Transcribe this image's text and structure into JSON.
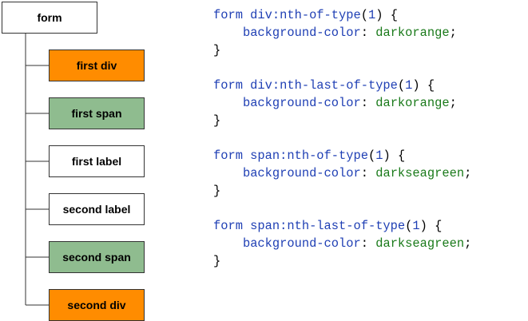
{
  "colors": {
    "darkorange": "#ff8c00",
    "darkseagreen": "#8fbc8f",
    "white": "#ffffff",
    "selector_blue": "#1f3fb4",
    "value_green": "#1a7a1a"
  },
  "tree": {
    "root": {
      "label": "form"
    },
    "children": [
      {
        "label": "first div",
        "fill": "#ff8c00"
      },
      {
        "label": "first span",
        "fill": "#8fbc8f"
      },
      {
        "label": "first label",
        "fill": "#ffffff"
      },
      {
        "label": "second label",
        "fill": "#ffffff"
      },
      {
        "label": "second span",
        "fill": "#8fbc8f"
      },
      {
        "label": "second div",
        "fill": "#ff8c00"
      }
    ]
  },
  "css_rules": [
    {
      "selector": "form div:nth-of-type",
      "arg": "1",
      "property": "background-color",
      "value": "darkorange"
    },
    {
      "selector": "form div:nth-last-of-type",
      "arg": "1",
      "property": "background-color",
      "value": "darkorange"
    },
    {
      "selector": "form span:nth-of-type",
      "arg": "1",
      "property": "background-color",
      "value": "darkseagreen"
    },
    {
      "selector": "form span:nth-last-of-type",
      "arg": "1",
      "property": "background-color",
      "value": "darkseagreen"
    }
  ]
}
